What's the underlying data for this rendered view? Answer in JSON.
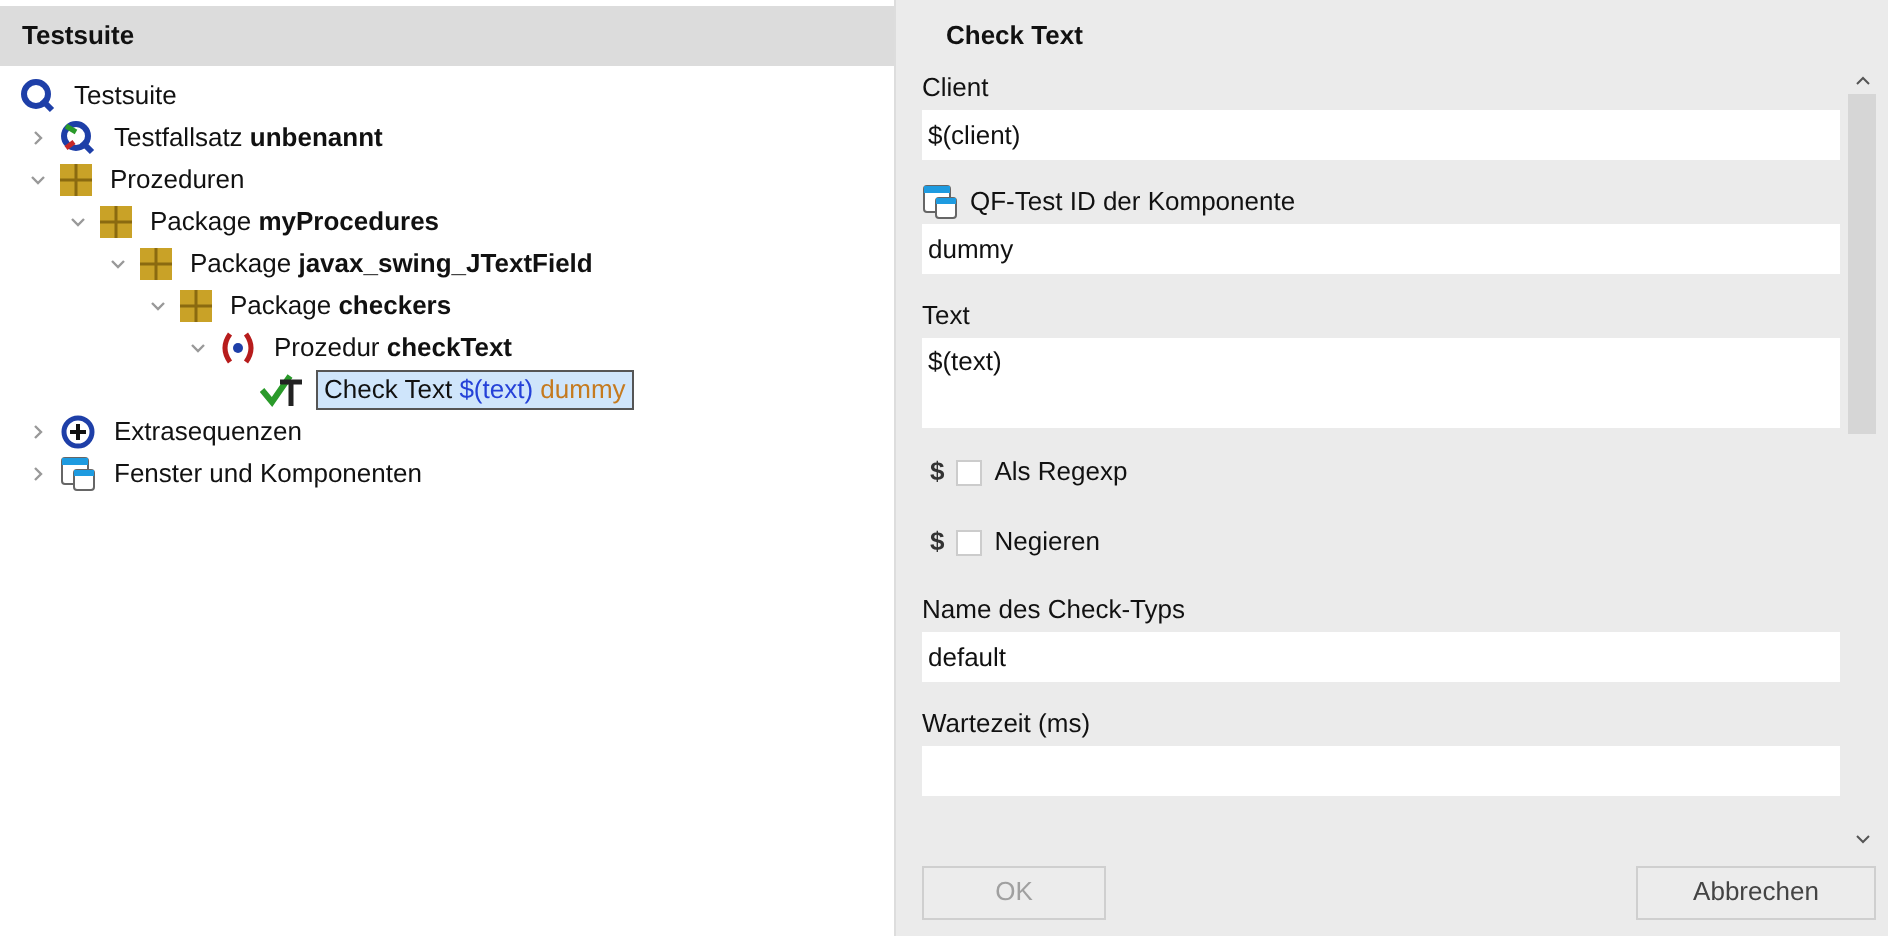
{
  "tree": {
    "title": "Testsuite",
    "nodes": [
      {
        "kind": "suite",
        "selected": false,
        "label": "Testsuite",
        "children": [
          {
            "kind": "testset",
            "selected": false,
            "expanded": false,
            "label": "Testfallsatz **unbenannt**"
          },
          {
            "kind": "package",
            "selected": false,
            "expanded": true,
            "label": "Prozeduren",
            "children": [
              {
                "kind": "package",
                "selected": false,
                "expanded": true,
                "label": "Package **myProcedures**",
                "children": [
                  {
                    "kind": "package",
                    "selected": false,
                    "expanded": true,
                    "label": "Package **javax_swing_JTextField**",
                    "children": [
                      {
                        "kind": "package",
                        "selected": false,
                        "expanded": true,
                        "label": "Package **checkers**",
                        "children": [
                          {
                            "kind": "procedure",
                            "selected": false,
                            "expanded": true,
                            "label": "Prozedur **checkText**",
                            "children": [
                              {
                                "kind": "check",
                                "selected": true,
                                "label": "Check Text",
                                "variable": "$(text)",
                                "component": "dummy"
                              }
                            ]
                          }
                        ]
                      }
                    ]
                  }
                ]
              }
            ]
          },
          {
            "kind": "extras",
            "selected": false,
            "expanded": false,
            "label": "Extrasequenzen"
          },
          {
            "kind": "windows",
            "selected": false,
            "expanded": false,
            "label": "Fenster und Komponenten"
          }
        ]
      }
    ]
  },
  "details": {
    "title": "Check Text",
    "fields": [
      {
        "kind": "text",
        "label": "Client",
        "value": "$(client)"
      },
      {
        "kind": "component",
        "label": "QF-Test ID der Komponente",
        "value": "dummy"
      },
      {
        "kind": "textarea",
        "label": "Text",
        "value": "$(text)"
      },
      {
        "kind": "checkbox",
        "prefix": "$",
        "label": "Als Regexp",
        "checked": false
      },
      {
        "kind": "checkbox",
        "prefix": "$",
        "label": "Negieren",
        "checked": false
      },
      {
        "kind": "text",
        "label": "Name des Check-Typs",
        "value": "default"
      },
      {
        "kind": "text",
        "label": "Wartezeit (ms)"
      }
    ]
  },
  "buttons": [
    {
      "label": "OK",
      "disabled": true
    },
    {
      "label": "Abbrechen",
      "disabled": false
    }
  ]
}
